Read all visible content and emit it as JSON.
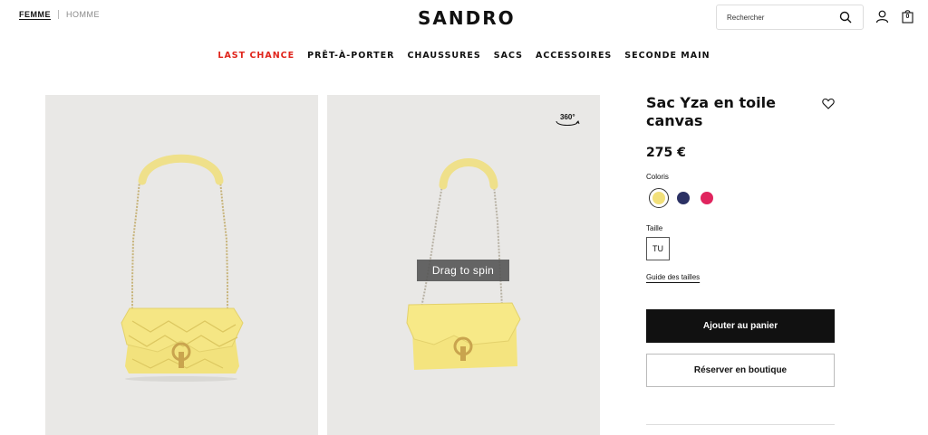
{
  "header": {
    "gender_active": "FEMME",
    "gender_inactive": "HOMME",
    "logo": "SANDRO",
    "search_placeholder": "Rechercher",
    "icons": [
      "search-icon",
      "user-icon",
      "bag-icon"
    ],
    "bag_count": "0"
  },
  "nav": {
    "items": [
      {
        "label": "LAST CHANCE",
        "highlight": true
      },
      {
        "label": "PRÊT-À-PORTER"
      },
      {
        "label": "CHAUSSURES"
      },
      {
        "label": "SACS"
      },
      {
        "label": "ACCESSOIRES"
      },
      {
        "label": "SECONDE MAIN"
      }
    ],
    "highlight_color": "#e0241b"
  },
  "gallery": {
    "spin_icon": "360-icon",
    "spin_label": "360°",
    "drag_tooltip": "Drag to spin",
    "product_color": "#f3e57d"
  },
  "product": {
    "title": "Sac Yza en toile canvas",
    "price": "275 €",
    "coloris_label": "Coloris",
    "colors": [
      {
        "name": "yellow",
        "hex": "#f2e07a",
        "selected": true
      },
      {
        "name": "navy",
        "hex": "#2b3164"
      },
      {
        "name": "pink",
        "hex": "#e0245e"
      }
    ],
    "taille_label": "Taille",
    "size": "TU",
    "size_guide": "Guide des tailles",
    "add_to_cart": "Ajouter au panier",
    "reserve": "Réserver en boutique"
  }
}
